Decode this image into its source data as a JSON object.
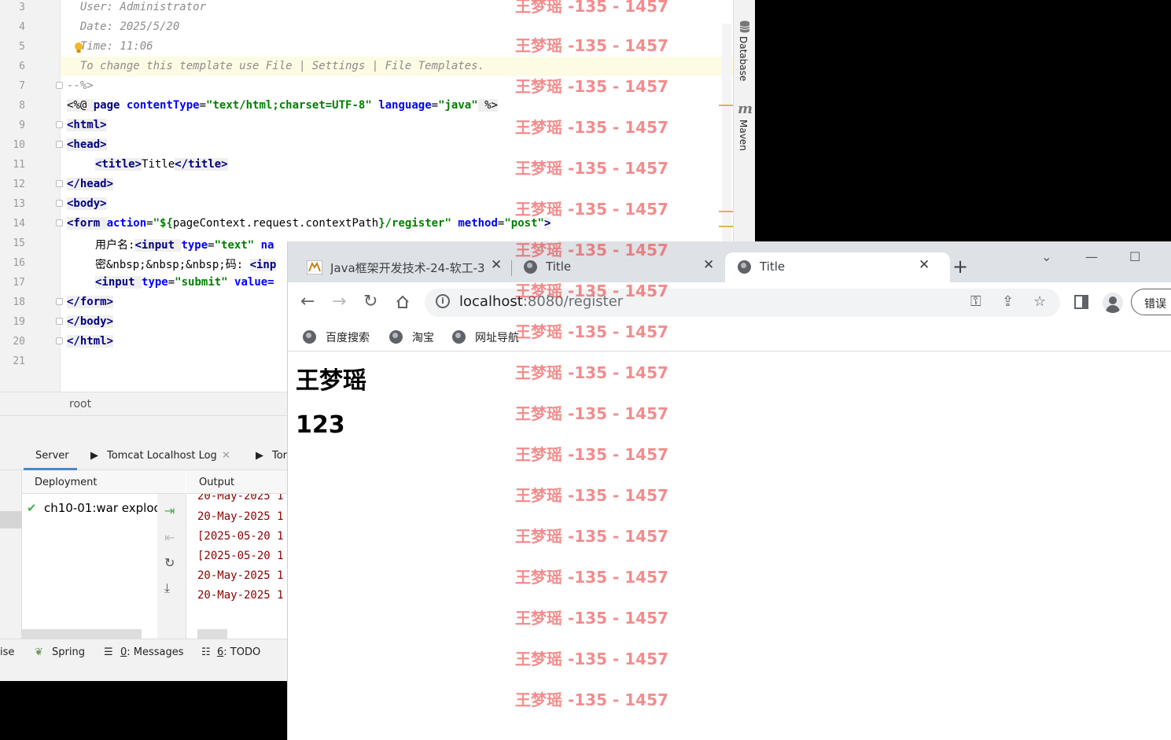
{
  "editor": {
    "line_numbers": [
      "3",
      "4",
      "5",
      "6",
      "7",
      "8",
      "9",
      "10",
      "11",
      "12",
      "13",
      "14",
      "15",
      "16",
      "17",
      "18",
      "19",
      "20",
      "21"
    ],
    "lines": {
      "l3": "  User: Administrator",
      "l4": "  Date: 2025/5/20",
      "l5": "  Time: 11:06",
      "l6": "  To change this template use File | Settings | File Templates.",
      "l7": "--%>",
      "l8": {
        "open": "<%@ ",
        "page": "page",
        "ct_attr": "contentType",
        "eq1": "=",
        "ct_val": "\"text/html;charset=UTF-8\"",
        "lang_attr": "language",
        "eq2": "=",
        "lang_val": "\"java\"",
        "close": " %>"
      },
      "l9": "<html>",
      "l10": "<head>",
      "l11": {
        "open": "<title>",
        "text": "Title",
        "close": "</title>"
      },
      "l12": "</head>",
      "l13": "<body>",
      "l14": {
        "open": "<form ",
        "action_attr": "action",
        "eq1": "=",
        "action_val": "\"${",
        "action_expr": "pageContext.request.contextPath",
        "action_val2": "}/register\"",
        "method_attr": "method",
        "eq2": "=",
        "method_val": "\"post\"",
        "close": ">"
      },
      "l15": {
        "label": "用户名:",
        "open": "<input ",
        "type_attr": "type",
        "eq": "=",
        "type_val": "\"text\"",
        "rest": " na"
      },
      "l16": {
        "label": "密&nbsp;&nbsp;&nbsp;码: ",
        "open": "<inp"
      },
      "l17": {
        "open": "<input ",
        "type_attr": "type",
        "eq": "=",
        "type_val": "\"submit\"",
        "rest": " value="
      },
      "l18": "</form>",
      "l19": "</body>",
      "l20": "</html>"
    },
    "breadcrumb": "root"
  },
  "side_tools": {
    "database": "Database",
    "maven": "Maven"
  },
  "run_panel": {
    "tabs": {
      "server": "Server",
      "tomcat_log": "Tomcat Localhost Log",
      "third": "Tor"
    },
    "deployment_header": "Deployment",
    "output_header": "Output",
    "deployment_item": "ch10-01:war explod",
    "output_lines": [
      "20-May-2025 1",
      "20-May-2025 1",
      "[2025-05-20 1",
      "[2025-05-20 1",
      "20-May-2025 1",
      "20-May-2025 1"
    ]
  },
  "status_bar": {
    "ise": "ise",
    "spring": "Spring",
    "messages_num": "0",
    "messages": ": Messages",
    "todo_num": "6",
    "todo": ": TODO"
  },
  "browser": {
    "tabs": [
      {
        "title": "Java框架开发技术-24-软工-3",
        "close": "✕"
      },
      {
        "title": "Title",
        "close": "✕"
      },
      {
        "title": "Title",
        "close": "✕"
      }
    ],
    "new_tab": "+",
    "url_host": "localhost",
    "url_rest": ":8080/register",
    "error_button": "错误",
    "bookmarks": [
      "百度搜索",
      "淘宝",
      "网址导航"
    ],
    "page": {
      "heading1": "王梦瑶",
      "heading2": "123"
    }
  },
  "watermark": {
    "text": "王梦瑶 -135 - 1457"
  },
  "colors": {
    "watermark": "#eb4646",
    "tag": "#000080",
    "attr": "#0000ff",
    "string": "#008000",
    "comment": "#8c8c8c"
  }
}
